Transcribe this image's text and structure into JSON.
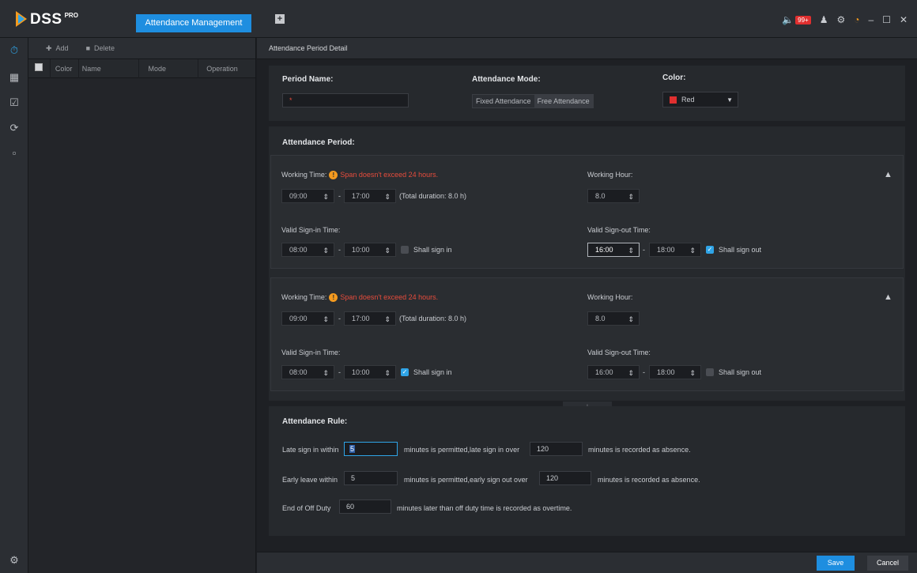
{
  "app": {
    "logo": "DSS",
    "logo_sup": "PRO",
    "module_tab": "Attendance Management",
    "new_tab": "+",
    "alarm_count": "99+"
  },
  "list_toolbar": {
    "add": "Add",
    "delete": "Delete"
  },
  "list_columns": {
    "color": "Color",
    "name": "Name",
    "mode": "Mode",
    "operation": "Operation"
  },
  "detail": {
    "title": "Attendance Period Detail"
  },
  "period_name": {
    "label": "Period Name:",
    "required_mark": "*"
  },
  "attendance_mode": {
    "label": "Attendance Mode:",
    "options": [
      "Fixed Attendance",
      "Free Attendance"
    ],
    "selected": "Free Attendance"
  },
  "color": {
    "label": "Color:",
    "value": "Red",
    "swatch": "#e02f2f"
  },
  "attendance_period": {
    "label": "Attendance Period:"
  },
  "periods": [
    {
      "working_time_label": "Working Time:",
      "warning": "Span doesn't exceed 24 hours.",
      "start": "09:00",
      "end": "17:00",
      "duration": "(Total duration: 8.0 h)",
      "working_hour_label": "Working Hour:",
      "working_hour": "8.0",
      "sign_in_label": "Valid Sign-in Time:",
      "sign_in_start": "08:00",
      "sign_in_end": "10:00",
      "shall_sign_in": "Shall sign in",
      "shall_sign_in_checked": false,
      "sign_out_label": "Valid Sign-out Time:",
      "sign_out_start": "16:00",
      "sign_out_end": "18:00",
      "shall_sign_out": "Shall sign out",
      "shall_sign_out_checked": true
    },
    {
      "working_time_label": "Working Time:",
      "warning": "Span doesn't exceed 24 hours.",
      "start": "09:00",
      "end": "17:00",
      "duration": "(Total duration: 8.0 h)",
      "working_hour_label": "Working Hour:",
      "working_hour": "8.0",
      "sign_in_label": "Valid Sign-in Time:",
      "sign_in_start": "08:00",
      "sign_in_end": "10:00",
      "shall_sign_in": "Shall sign in",
      "shall_sign_in_checked": true,
      "sign_out_label": "Valid Sign-out Time:",
      "sign_out_start": "16:00",
      "sign_out_end": "18:00",
      "shall_sign_out": "Shall sign out",
      "shall_sign_out_checked": false
    }
  ],
  "add_period": "+",
  "rule": {
    "label": "Attendance Rule:",
    "late_prefix": "Late sign in within",
    "late_value": "5",
    "late_mid": "minutes is permitted,late sign in over",
    "late_absence": "120",
    "late_suffix": "minutes is recorded as absence.",
    "early_prefix": "Early leave within",
    "early_value": "5",
    "early_mid": "minutes is permitted,early sign out over",
    "early_absence": "120",
    "early_suffix": "minutes is recorded as absence.",
    "offduty_prefix": "End of Off Duty",
    "offduty_value": "60",
    "offduty_suffix": "minutes later than off duty time is recorded as overtime."
  },
  "footer": {
    "save": "Save",
    "cancel": "Cancel"
  },
  "colors": {
    "accent": "#1e8ee0",
    "warning": "#e74c3c",
    "checkbox_on": "#2fa4e7"
  }
}
